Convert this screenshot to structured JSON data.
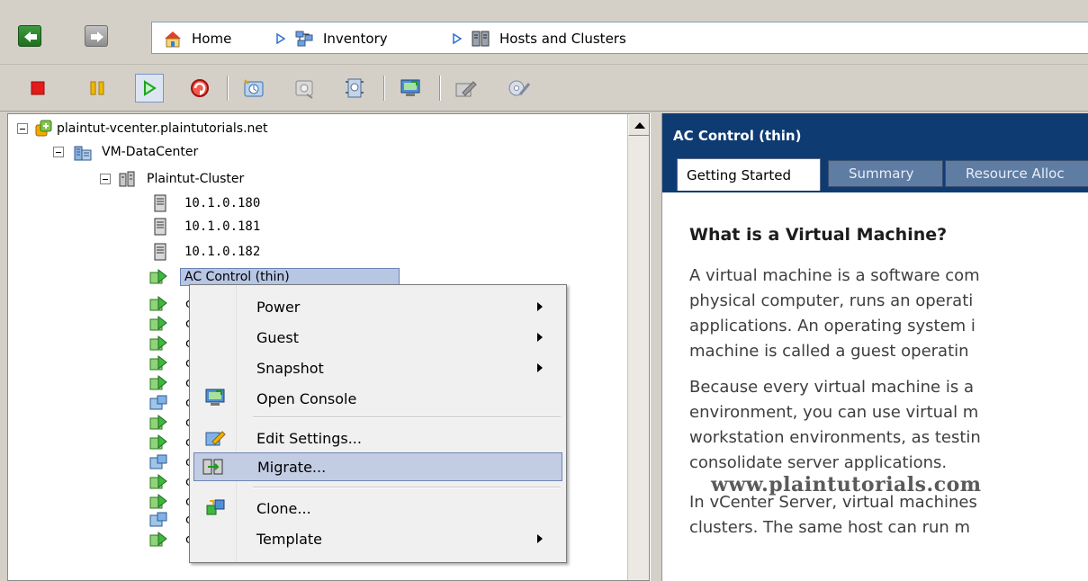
{
  "breadcrumb": {
    "items": [
      {
        "label": "Home",
        "icon": "home-icon"
      },
      {
        "label": "Inventory",
        "icon": "inventory-icon"
      },
      {
        "label": "Hosts and Clusters",
        "icon": "hosts-clusters-icon"
      }
    ]
  },
  "toolbar": {
    "buttons": [
      {
        "name": "power-off",
        "icon": "stop-icon",
        "color": "#e31b1b"
      },
      {
        "name": "suspend",
        "icon": "pause-icon",
        "color": "#f0b800"
      },
      {
        "name": "power-on",
        "icon": "play-icon",
        "color": "#1ea51e"
      },
      {
        "name": "reset",
        "icon": "reset-icon",
        "color": "#d82020"
      },
      {
        "name": "take-snapshot",
        "icon": "snapshot-icon"
      },
      {
        "name": "revert-snapshot",
        "icon": "revert-snapshot-icon"
      },
      {
        "name": "snapshot-manager",
        "icon": "snapshot-manager-icon"
      },
      {
        "name": "console",
        "icon": "console-icon"
      },
      {
        "name": "edit-settings",
        "icon": "edit-settings-icon"
      },
      {
        "name": "migrate",
        "icon": "migrate-disk-icon"
      }
    ]
  },
  "tree": {
    "vcenter": "plaintut-vcenter.plaintutorials.net",
    "datacenter": "VM-DataCenter",
    "cluster": "Plaintut-Cluster",
    "hosts": [
      "10.1.0.180",
      "10.1.0.181",
      "10.1.0.182"
    ],
    "selected_vm": "AC Control (thin)",
    "partial_vm_char": "c"
  },
  "context_menu": {
    "items": [
      {
        "label": "Power",
        "submenu": true
      },
      {
        "label": "Guest",
        "submenu": true
      },
      {
        "label": "Snapshot",
        "submenu": true
      },
      {
        "label": "Open Console",
        "icon": "console-icon"
      },
      {
        "label": "Edit Settings...",
        "icon": "edit-settings-icon"
      },
      {
        "label": "Migrate...",
        "icon": "migrate-icon",
        "highlighted": true
      },
      {
        "label": "Clone...",
        "icon": "clone-icon"
      },
      {
        "label": "Template",
        "submenu": true
      }
    ]
  },
  "details": {
    "title": "AC Control (thin)",
    "tabs": [
      "Getting Started",
      "Summary",
      "Resource Alloc"
    ],
    "heading": "What is a Virtual Machine?",
    "paragraph1": [
      "A virtual machine is a software com",
      "physical computer, runs an operati",
      "applications. An operating system i",
      "machine is called a guest operatin"
    ],
    "paragraph2": [
      "Because every virtual machine is a",
      "environment, you can use virtual m",
      "workstation environments, as testin",
      "consolidate server applications."
    ],
    "paragraph3": [
      "In vCenter Server, virtual machines",
      "clusters. The same host can run m"
    ]
  },
  "watermark": "www.plaintutorials.com",
  "colors": {
    "header_bg": "#0f3b73",
    "selection": "#b7c6e3",
    "menu_highlight": "#c2cde4"
  }
}
